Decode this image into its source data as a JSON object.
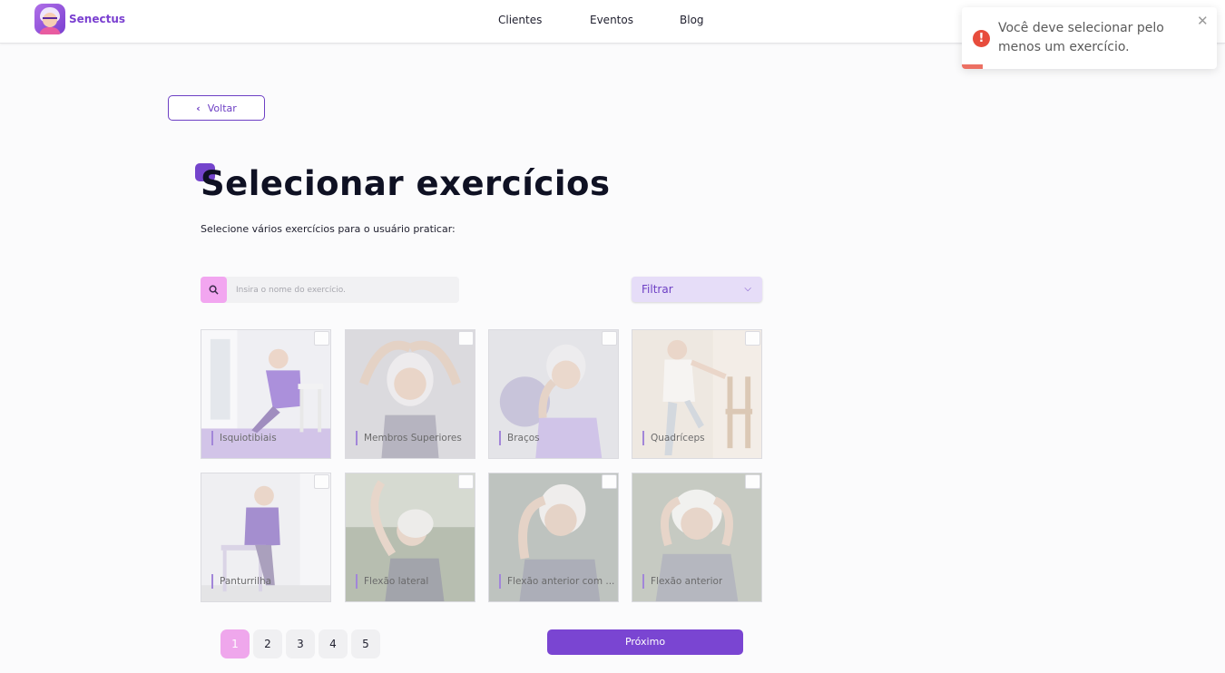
{
  "header": {
    "brand": "Senectus",
    "nav": [
      "Clientes",
      "Eventos",
      "Blog"
    ]
  },
  "toast": {
    "message": "Você deve selecionar pelo menos um exercício.",
    "close_icon": "close-icon",
    "icon": "error-icon",
    "color": "#e74c3c"
  },
  "back_button": {
    "label": "Voltar",
    "icon": "chevron-left-icon"
  },
  "title": "Selecionar exercícios",
  "subtitle": "Selecione vários exercícios para o usuário praticar:",
  "search": {
    "placeholder": "Insira o nome do exercício.",
    "value": "",
    "icon": "search-icon"
  },
  "filter": {
    "label": "Filtrar",
    "icon": "chevron-down-icon"
  },
  "exercises": [
    {
      "name": "Isquiotibiais",
      "checked": false
    },
    {
      "name": "Membros Superiores",
      "checked": false
    },
    {
      "name": "Braços",
      "checked": false
    },
    {
      "name": "Quadríceps",
      "checked": false
    },
    {
      "name": "Panturrilha",
      "checked": false
    },
    {
      "name": "Flexão lateral",
      "checked": false
    },
    {
      "name": "Flexão anterior com ...",
      "checked": false
    },
    {
      "name": "Flexão anterior",
      "checked": false
    }
  ],
  "pagination": {
    "pages": [
      "1",
      "2",
      "3",
      "4",
      "5"
    ],
    "current": "1"
  },
  "next_button": {
    "label": "Próximo"
  },
  "colors": {
    "accent": "#7a45d2",
    "pink": "#efa7ec",
    "error": "#e74c3c"
  }
}
